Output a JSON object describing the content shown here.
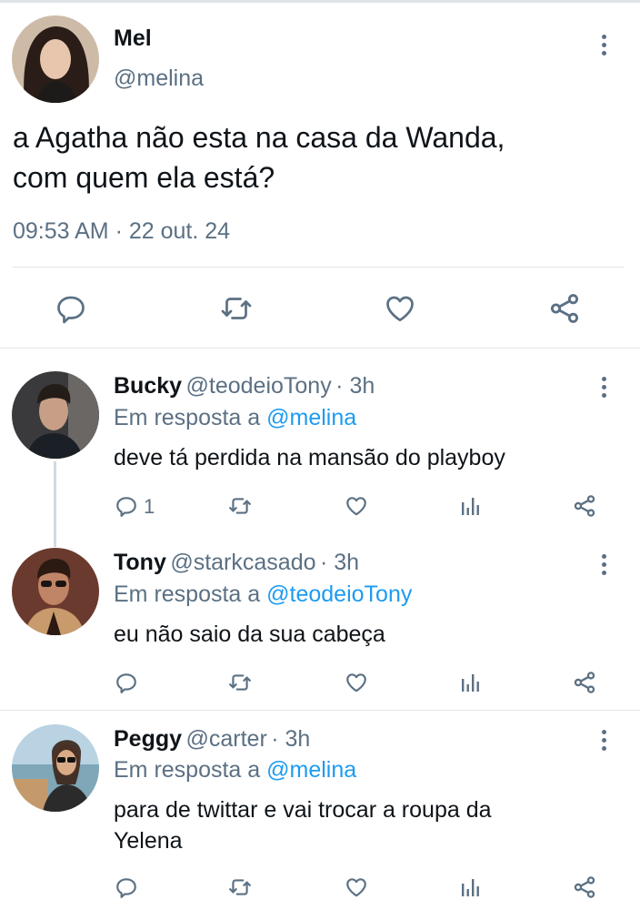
{
  "main_tweet": {
    "name": "Mel",
    "handle": "@melina",
    "text_line1": "a Agatha não esta na casa da Wanda,",
    "text_line2": "com quem ela está?",
    "timestamp": "09:53 AM · 22 out. 24"
  },
  "replies": [
    {
      "name": "Bucky",
      "handle": "@teodeioTony",
      "time": "· 3h",
      "reply_prefix": "Em resposta a",
      "reply_to": "@melina",
      "text": "deve tá perdida na mansão do playboy",
      "reply_count": "1"
    },
    {
      "name": "Tony",
      "handle": "@starkcasado",
      "time": "· 3h",
      "reply_prefix": "Em resposta a",
      "reply_to": "@teodeioTony",
      "text": "eu não saio da sua cabeça",
      "reply_count": ""
    },
    {
      "name": "Peggy",
      "handle": "@carter",
      "time": "· 3h",
      "reply_prefix": "Em resposta a",
      "reply_to": "@melina",
      "text_line1": "para de twittar e vai trocar a roupa da",
      "text_line2": "Yelena",
      "reply_count": ""
    }
  ],
  "icons": {
    "reply": "reply-icon",
    "retweet": "retweet-icon",
    "like": "heart-icon",
    "share": "share-icon",
    "analytics": "analytics-icon",
    "more": "more-options-icon"
  },
  "colors": {
    "text": "#0f1419",
    "muted": "#5b7083",
    "link": "#1d9bf0",
    "divider": "#e1e4e6"
  }
}
